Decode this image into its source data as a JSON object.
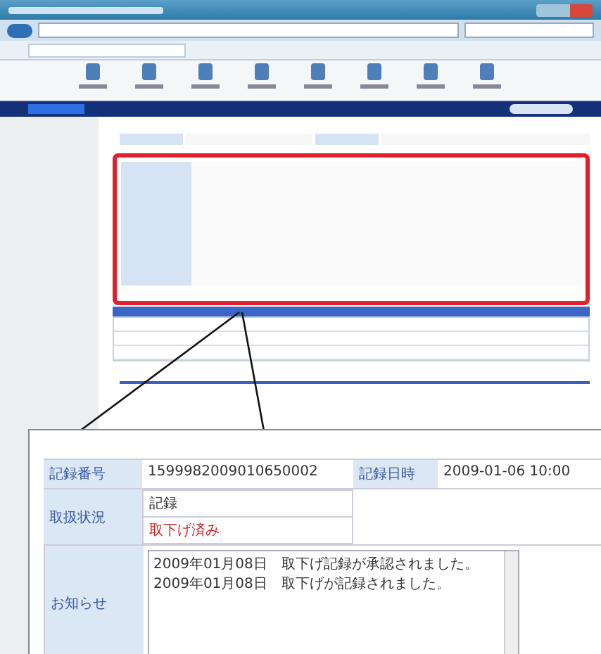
{
  "callout": {
    "record_number": {
      "label": "記録番号",
      "value": "1599982009010650002"
    },
    "record_datetime": {
      "label": "記録日時",
      "value": "2009-01-06 10:00"
    },
    "status": {
      "label": "取扱状況",
      "values": [
        {
          "text": "記録",
          "kind": "normal"
        },
        {
          "text": "取下げ済み",
          "kind": "alert"
        }
      ]
    },
    "notice": {
      "label": "お知らせ",
      "lines": [
        "2009年01月08日　取下げ記録が承認されました。",
        "2009年01月08日　取下げが記録されました。"
      ]
    }
  }
}
